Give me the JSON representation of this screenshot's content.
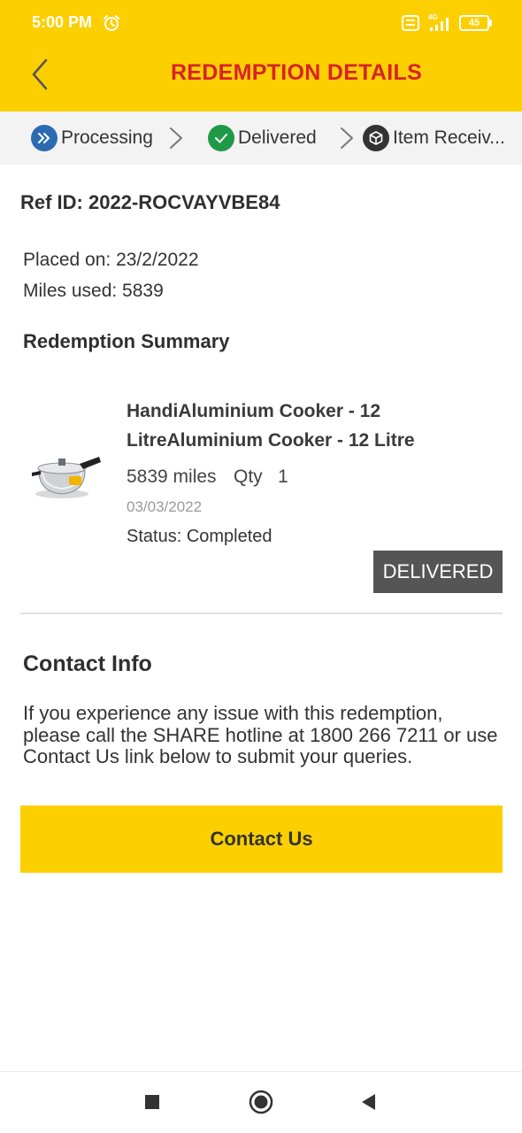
{
  "status_bar": {
    "time": "5:00 PM",
    "network_badge": "4G",
    "battery": "45",
    "icons": [
      "alarm-icon",
      "volte-icon",
      "signal-icon",
      "battery-icon"
    ]
  },
  "header": {
    "title": "REDEMPTION DETAILS",
    "back_icon": "chevron-left-icon",
    "background_color": "#FCCF00",
    "title_color": "#D8222A"
  },
  "tracker": {
    "steps": [
      {
        "label": "Processing",
        "icon": "double-chevron-icon",
        "color": "#2B6CB0"
      },
      {
        "label": "Delivered",
        "icon": "check-icon",
        "color": "#1E9A47"
      },
      {
        "label": "Item Receiv...",
        "icon": "package-icon",
        "color": "#333333"
      }
    ]
  },
  "order": {
    "ref_id": "Ref ID: 2022-ROCVAYVBE84",
    "placed_on": "Placed on: 23/2/2022",
    "miles_used": "Miles used: 5839"
  },
  "summary": {
    "title": "Redemption Summary",
    "item": {
      "name": "HandiAluminium Cooker - 12 LitreAluminium Cooker - 12 Litre",
      "miles": "5839 miles",
      "qty": "Qty   1",
      "date": "03/03/2022",
      "status": "Status: Completed",
      "badge": "DELIVERED"
    }
  },
  "contact": {
    "title": "Contact Info",
    "text": "If you experience any issue with this redemption, please call the SHARE hotline at 1800 266 7211 or use Contact Us link below to submit your queries.",
    "button": "Contact Us"
  },
  "navbar": {
    "icons": [
      "recents-icon",
      "home-icon",
      "back-icon"
    ]
  }
}
